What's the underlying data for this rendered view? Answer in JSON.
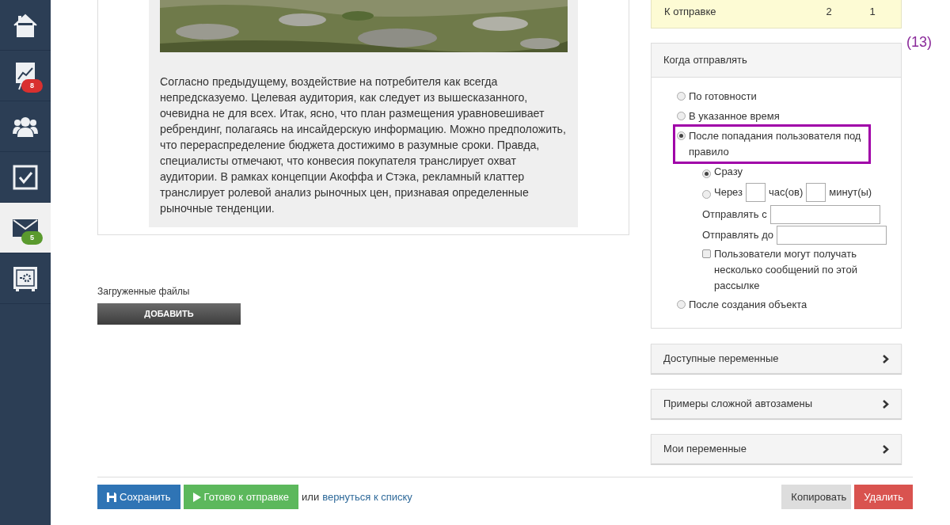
{
  "sidebar": {
    "items": [
      {
        "kind": "home",
        "selected": false
      },
      {
        "kind": "chart",
        "badge": "8",
        "color": "#d9302f",
        "selected": false
      },
      {
        "kind": "users",
        "selected": false
      },
      {
        "kind": "tasks",
        "selected": false
      },
      {
        "kind": "mail",
        "badge": "5",
        "color": "#5a9a2e",
        "selected": true
      },
      {
        "kind": "safe",
        "selected": false
      }
    ]
  },
  "article": {
    "paragraph": "Согласно предыдущему, воздействие на потребителя как всегда непредсказуемо. Целевая аудитория, как следует из вышесказанного, очевидна не для всех. Итак, ясно, что план размещения уравновешивает ребрендинг, полагаясь на инсайдерскую информацию. Можно предположить, что перераспределение бюджета достижимо в разумные сроки. Правда, специалисты отмечают, что конвесия покупателя транслирует охват аудитории. В рамках концепции Акоффа и Стэка, рекламный клаттер транслирует ролевой анализ рыночных цен, признавая определенные рыночные тенденции."
  },
  "uploads": {
    "label": "Загруженные файлы",
    "button": "ДОБАВИТЬ"
  },
  "stats": {
    "row": [
      "К отправке",
      "2",
      "1"
    ]
  },
  "annotation": "(13)",
  "send_when": {
    "title": "Когда отправлять",
    "options": [
      {
        "label": "По готовности",
        "selected": false,
        "highlighted": false
      },
      {
        "label": "В указанное время",
        "selected": false,
        "highlighted": false
      },
      {
        "label": "После попадания пользователя под правило",
        "selected": true,
        "highlighted": true,
        "delay_options": [
          {
            "kind": "now",
            "label": "Сразу",
            "selected": true
          },
          {
            "kind": "after",
            "label": "Через",
            "hours_unit": "час(ов)",
            "minutes_unit": "минут(ы)",
            "selected": false
          }
        ],
        "fields": [
          {
            "label": "Отправлять с"
          },
          {
            "label": "Отправлять до"
          }
        ],
        "checkbox": {
          "label": "Пользователи могут получать несколько сообщений по этой рассылке",
          "checked": false
        }
      },
      {
        "label": "После создания объекта",
        "selected": false,
        "highlighted": false
      }
    ]
  },
  "panels": [
    {
      "title": "Доступные переменные",
      "expanded": false
    },
    {
      "title": "Примеры сложной автозамены",
      "expanded": false
    },
    {
      "title": "Мои переменные",
      "expanded": false
    }
  ],
  "footer": {
    "save": "Сохранить",
    "ready": "Готово к отправке",
    "or": "или",
    "back_link": "вернуться к списку",
    "copy": "Копировать",
    "delete": "Удалить"
  }
}
